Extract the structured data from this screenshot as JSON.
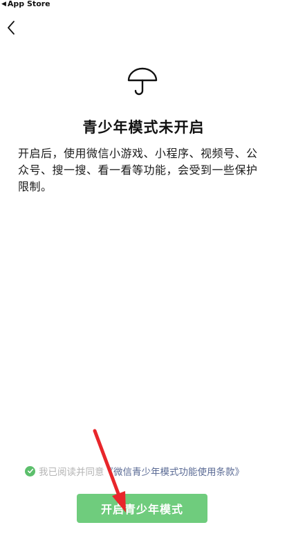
{
  "status_bar": {
    "back_app_label": "App Store"
  },
  "nav": {
    "back_icon": "chevron-left-icon"
  },
  "hero": {
    "icon": "umbrella-icon",
    "title": "青少年模式未开启",
    "description": "开启后，使用微信小游戏、小程序、视频号、公众号、搜一搜、看一看等功能，会受到一些保护限制。"
  },
  "agreement": {
    "checked": true,
    "text": "我已阅读并同意",
    "link_text": "《微信青少年模式功能使用条款》"
  },
  "primary_button": {
    "label": "开启青少年模式"
  },
  "colors": {
    "accent_green": "#6fcc7d",
    "check_green": "#5cbf6c",
    "link_blue": "#5b6b95",
    "annotation_red": "#e8262b"
  }
}
